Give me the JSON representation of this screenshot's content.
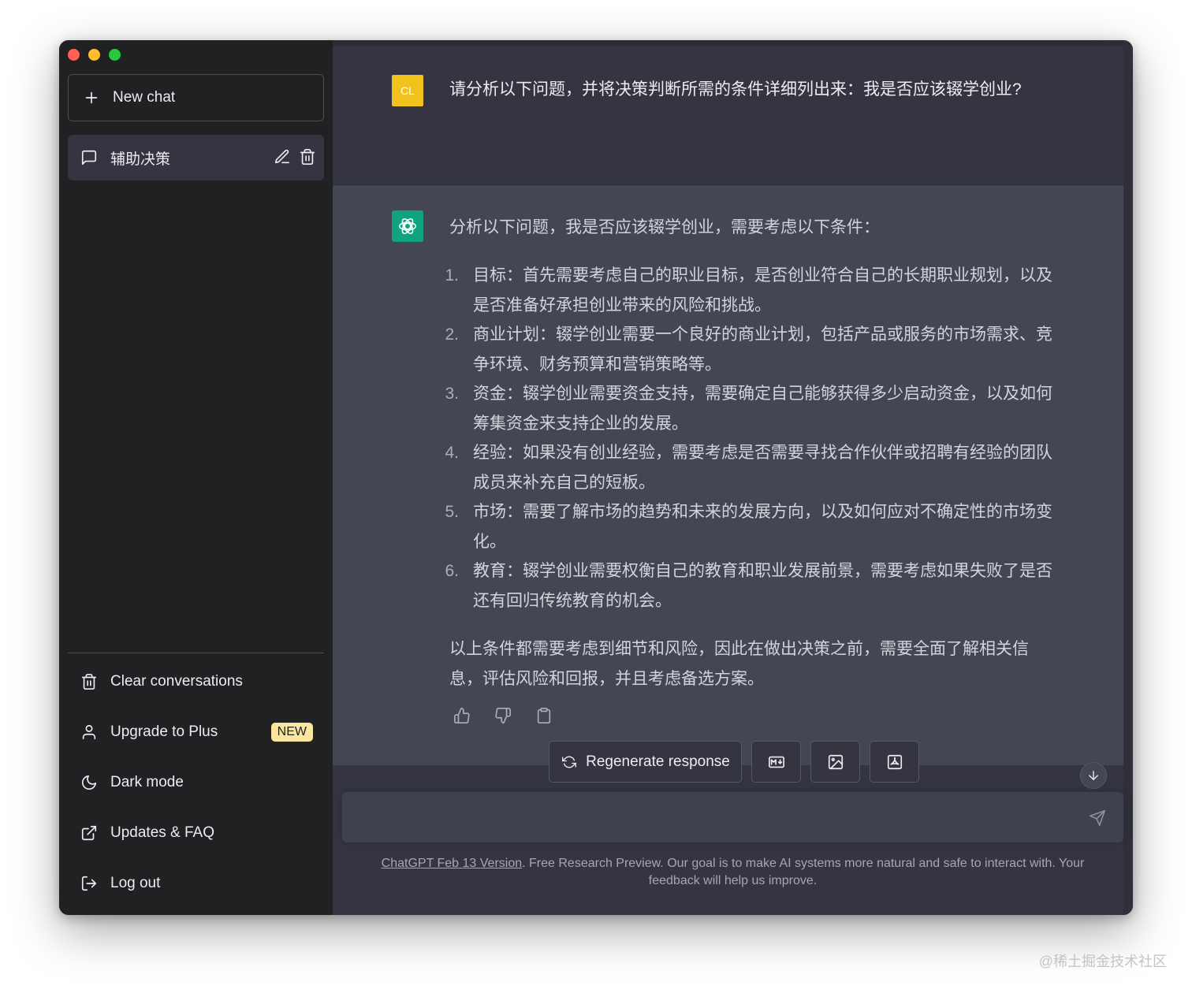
{
  "sidebar": {
    "new_chat_label": "New chat",
    "chats": [
      {
        "title": "辅助决策"
      }
    ],
    "menu": {
      "clear": "Clear conversations",
      "upgrade": "Upgrade to Plus",
      "upgrade_badge": "NEW",
      "dark_mode": "Dark mode",
      "updates": "Updates & FAQ",
      "logout": "Log out"
    }
  },
  "conversation": {
    "user": {
      "avatar_initials": "CL",
      "avatar_color": "#f0c21b",
      "text": "请分析以下问题，并将决策判断所需的条件详细列出来：我是否应该辍学创业?"
    },
    "assistant": {
      "avatar_color": "#10a37f",
      "intro": "分析以下问题，我是否应该辍学创业，需要考虑以下条件：",
      "items": [
        {
          "num": "1.",
          "text": "目标：首先需要考虑自己的职业目标，是否创业符合自己的长期职业规划，以及是否准备好承担创业带来的风险和挑战。"
        },
        {
          "num": "2.",
          "text": "商业计划：辍学创业需要一个良好的商业计划，包括产品或服务的市场需求、竞争环境、财务预算和营销策略等。"
        },
        {
          "num": "3.",
          "text": "资金：辍学创业需要资金支持，需要确定自己能够获得多少启动资金，以及如何筹集资金来支持企业的发展。"
        },
        {
          "num": "4.",
          "text": "经验：如果没有创业经验，需要考虑是否需要寻找合作伙伴或招聘有经验的团队成员来补充自己的短板。"
        },
        {
          "num": "5.",
          "text": "市场：需要了解市场的趋势和未来的发展方向，以及如何应对不确定性的市场变化。"
        },
        {
          "num": "6.",
          "text": "教育：辍学创业需要权衡自己的教育和职业发展前景，需要考虑如果失败了是否还有回归传统教育的机会。"
        }
      ],
      "outro": "以上条件都需要考虑到细节和风险，因此在做出决策之前，需要全面了解相关信息，评估风险和回报，并且考虑备选方案。"
    }
  },
  "actions": {
    "regenerate_label": "Regenerate response"
  },
  "input": {
    "value": "",
    "placeholder": ""
  },
  "footer": {
    "link_text": "ChatGPT Feb 13 Version",
    "text": ". Free Research Preview. Our goal is to make AI systems more natural and safe to interact with. Your feedback will help us improve."
  },
  "watermark": "@稀土掘金技术社区"
}
